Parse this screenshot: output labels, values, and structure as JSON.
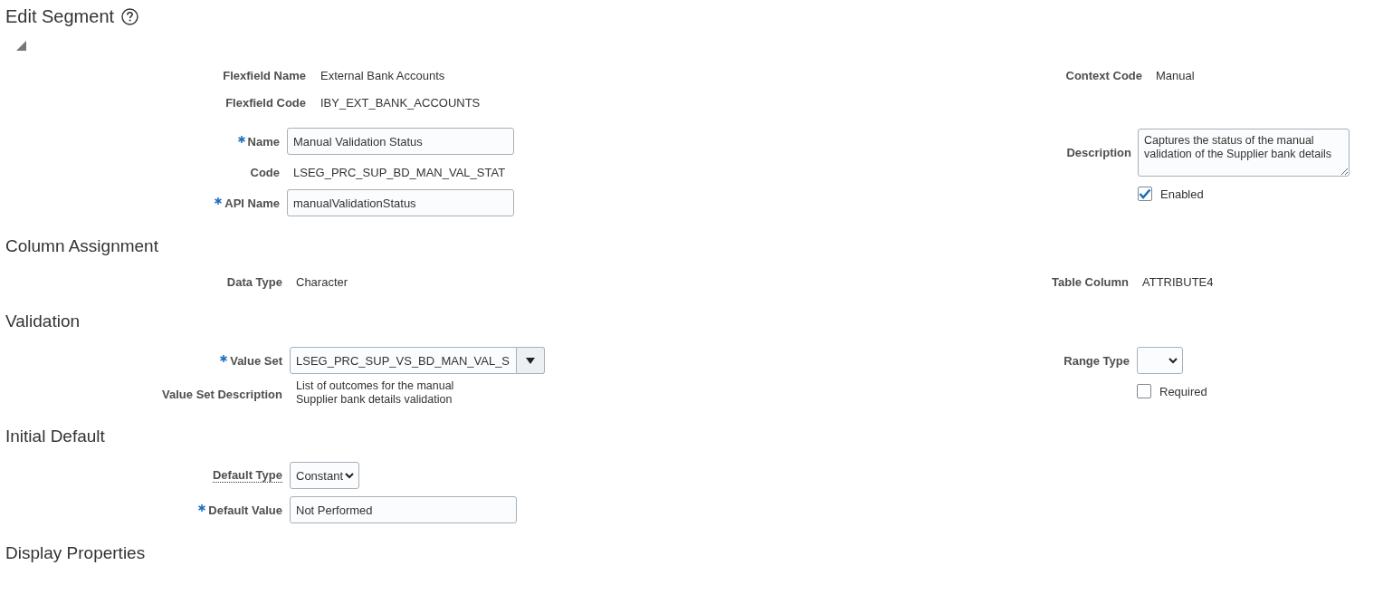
{
  "sections": [
    {
      "title": "Edit Segment",
      "kind": "page",
      "left": [
        {
          "rows": [
            {
              "kind": "text",
              "label": "Flexfield Name",
              "value": "External Bank Accounts",
              "required": false
            },
            {
              "kind": "text",
              "label": "Flexfield Code",
              "value": "IBY_EXT_BANK_ACCOUNTS",
              "required": false
            }
          ]
        },
        {
          "rows": [
            {
              "kind": "input",
              "label": "Name",
              "value": "Manual Validation Status",
              "required": true
            },
            {
              "kind": "text",
              "label": "Code",
              "value": "LSEG_PRC_SUP_BD_MAN_VAL_STAT",
              "required": false
            },
            {
              "kind": "input",
              "label": "API Name",
              "value": "manualValidationStatus",
              "required": true
            }
          ]
        }
      ],
      "right": [
        {
          "rows": [
            {
              "kind": "text",
              "label": "Context Code",
              "value": "Manual",
              "required": false
            }
          ]
        },
        {
          "rows": [
            {
              "kind": "textarea",
              "label": "Description",
              "value": "Captures the status of the manual validation of the Supplier bank details",
              "required": false
            },
            {
              "kind": "checkbox",
              "label": "Enabled",
              "checked": true,
              "required": false
            }
          ]
        }
      ]
    },
    {
      "title": "Column Assignment",
      "kind": "section",
      "left": [
        {
          "rows": [
            {
              "kind": "text",
              "label": "Data Type",
              "value": "Character",
              "required": false
            }
          ]
        }
      ],
      "right": [
        {
          "rows": [
            {
              "kind": "text",
              "label": "Table Column",
              "value": "ATTRIBUTE4",
              "required": false
            }
          ]
        }
      ]
    },
    {
      "title": "Validation",
      "kind": "section",
      "left": [
        {
          "rows": [
            {
              "kind": "lov",
              "label": "Value Set",
              "value": "LSEG_PRC_SUP_VS_BD_MAN_VAL_S",
              "required": true
            },
            {
              "kind": "note",
              "label": "Value Set Description",
              "lines": [
                "List of outcomes for the manual",
                "Supplier bank details validation"
              ],
              "required": false
            }
          ]
        }
      ],
      "right": [
        {
          "rows": [
            {
              "kind": "select",
              "label": "Range Type",
              "required": false
            },
            {
              "kind": "checkbox",
              "label": "Required",
              "checked": false,
              "required": false
            }
          ]
        }
      ]
    },
    {
      "title": "Initial Default",
      "kind": "section",
      "left": [
        {
          "rows": [
            {
              "kind": "select",
              "label": "Default Type",
              "value": "Constant",
              "required": false,
              "help": true
            },
            {
              "kind": "input",
              "label": "Default Value",
              "value": "Not Performed",
              "required": true
            }
          ]
        }
      ]
    },
    {
      "title": "Display Properties",
      "kind": "section"
    }
  ]
}
